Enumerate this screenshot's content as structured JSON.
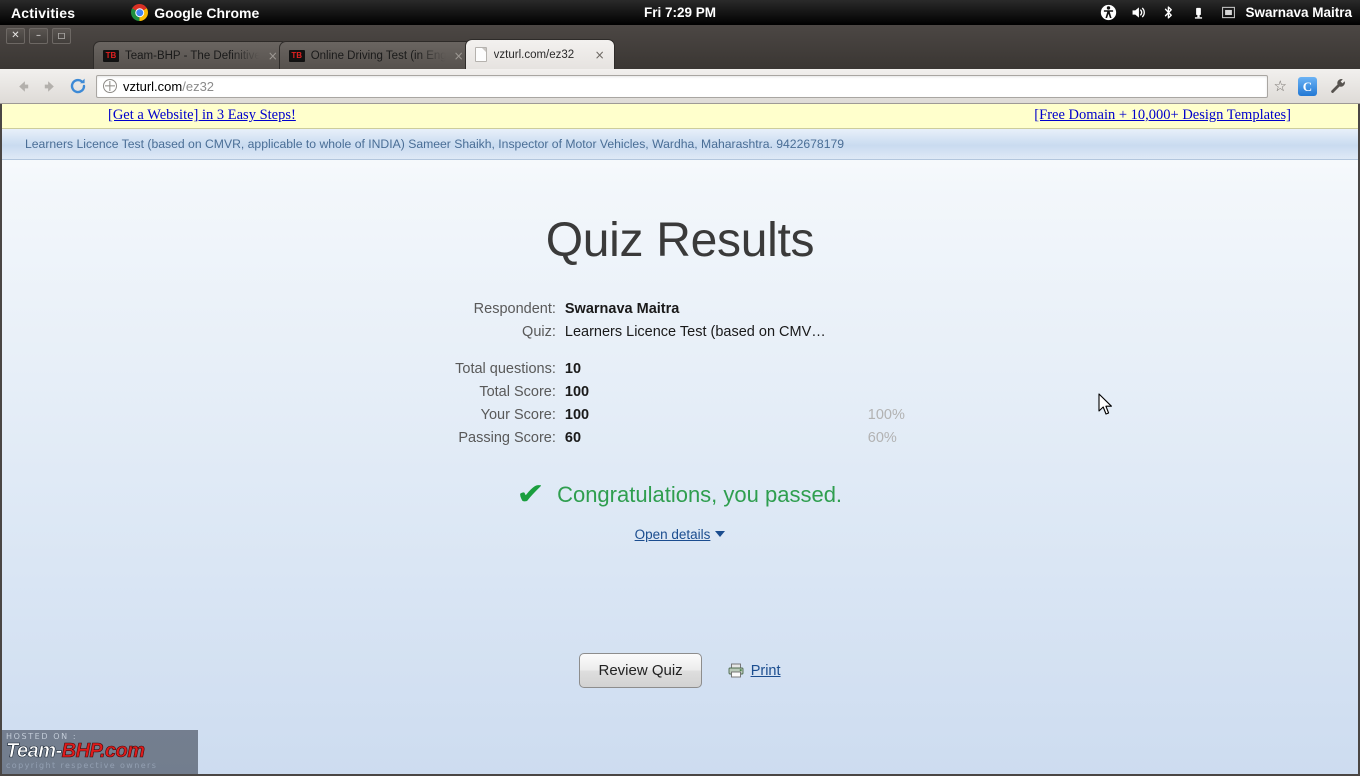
{
  "os_bar": {
    "activities": "Activities",
    "app_name": "Google Chrome",
    "clock": "Fri  7:29 PM",
    "user": "Swarnava Maitra",
    "tray_icons": [
      "accessibility-icon",
      "volume-icon",
      "bluetooth-icon",
      "battery-icon",
      "keyboard-layout-icon"
    ]
  },
  "window_controls": {
    "close": "✕",
    "minimize": "–",
    "maximize": "❐"
  },
  "tabs": [
    {
      "title": "Team-BHP - The Definitive",
      "favicon": "teambhp-favicon",
      "favicon_text": "TB",
      "active": false,
      "close": "×"
    },
    {
      "title": "Online Driving Test (in Eng",
      "favicon": "teambhp-favicon",
      "favicon_text": "TB",
      "active": false,
      "close": "×"
    },
    {
      "title": "vzturl.com/ez32",
      "favicon": "document-favicon",
      "favicon_text": "",
      "active": true,
      "close": "×"
    }
  ],
  "toolbar": {
    "back": "back-arrow-icon",
    "forward": "forward-arrow-icon",
    "reload": "reload-icon",
    "url_domain": "vzturl.com",
    "url_path": "/ez32",
    "bookmark_star": "☆",
    "extension_badge": "C",
    "menu": "wrench-icon"
  },
  "ad_banner": {
    "left_link": "[Get a Website] in 3 Easy Steps!",
    "right_link": "[Free Domain + 10,000+ Design Templates]"
  },
  "site_header": {
    "text": "Learners Licence Test (based on CMVR, applicable to whole of INDIA)  Sameer Shaikh, Inspector of Motor Vehicles, Wardha, Maharashtra.  9422678179"
  },
  "page": {
    "title": "Quiz Results",
    "info_rows": [
      {
        "label": "Respondent:",
        "value": "Swarnava Maitra",
        "bold": true,
        "percent": ""
      },
      {
        "label": "Quiz:",
        "value": "Learners Licence Test (based on CMV…",
        "bold": false,
        "percent": ""
      }
    ],
    "score_rows": [
      {
        "label": "Total questions:",
        "value": "10",
        "percent": ""
      },
      {
        "label": "Total Score:",
        "value": "100",
        "percent": ""
      },
      {
        "label": "Your Score:",
        "value": "100",
        "percent": "100%"
      },
      {
        "label": "Passing Score:",
        "value": "60",
        "percent": "60%"
      }
    ],
    "result": {
      "check": "✔",
      "message": "Congratulations, you passed.",
      "color": "#2f9e4f"
    },
    "open_details": "Open details",
    "review_button": "Review Quiz",
    "print_label": "Print"
  },
  "watermark": {
    "hosted_on": "HOSTED ON :",
    "logo_part1": "Team-",
    "logo_part2": "BHP",
    "logo_part3": ".com",
    "copyright": "copyright respective owners"
  }
}
